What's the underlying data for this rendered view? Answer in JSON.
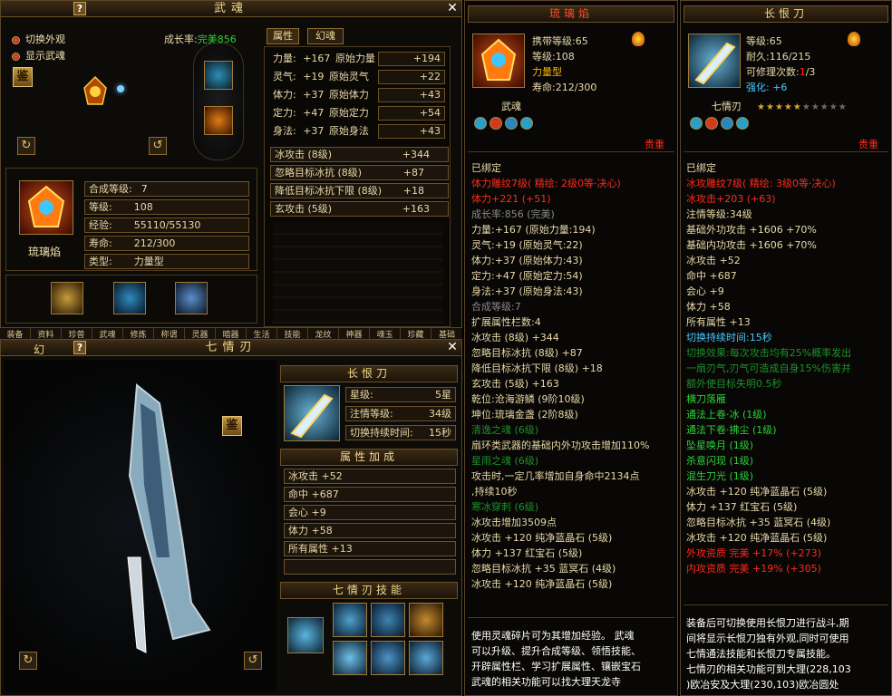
{
  "wuhun": {
    "title": "武魂",
    "opt_switch": "切换外观",
    "opt_show": "显示武魂",
    "growth_label": "成长率:",
    "growth_value": "完美856",
    "jian": "鉴",
    "tabs": [
      "属性",
      "幻魂"
    ],
    "stats": [
      {
        "label": "力量:",
        "base": "+167",
        "orig": "原始力量",
        "val": "+194"
      },
      {
        "label": "灵气:",
        "base": "+19",
        "orig": "原始灵气",
        "val": "+22"
      },
      {
        "label": "体力:",
        "base": "+37",
        "orig": "原始体力",
        "val": "+43"
      },
      {
        "label": "定力:",
        "base": "+47",
        "orig": "原始定力",
        "val": "+54"
      },
      {
        "label": "身法:",
        "base": "+37",
        "orig": "原始身法",
        "val": "+43"
      }
    ],
    "ext": [
      {
        "label": "冰攻击 (8级)",
        "val": "+344"
      },
      {
        "label": "忽略目标冰抗 (8级)",
        "val": "+87"
      },
      {
        "label": "降低目标冰抗下限 (8级)",
        "val": "+18"
      },
      {
        "label": "玄攻击 (5级)",
        "val": "+163"
      }
    ],
    "name": "琉璃焰",
    "info": [
      {
        "k": "合成等级:",
        "v": "7"
      },
      {
        "k": "等级:",
        "v": "108"
      },
      {
        "k": "经验:",
        "v": "55110/55130"
      },
      {
        "k": "寿命:",
        "v": "212/300"
      },
      {
        "k": "类型:",
        "v": "力量型"
      }
    ],
    "tabstrip": [
      "装备",
      "资料",
      "珍兽",
      "武魂",
      "修炼",
      "称谓",
      "灵器",
      "暗器",
      "生活",
      "技能",
      "龙纹",
      "神器",
      "魂玉",
      "珍藏",
      "基础"
    ]
  },
  "qiqing": {
    "title": "七情刃",
    "left_tab": "幻",
    "jian": "鉴",
    "weapon_name": "长恨刀",
    "star_label": "星级:",
    "star_value": "5星",
    "zhuqing_label": "注情等级:",
    "zhuqing_value": "34级",
    "switch_label": "切换持续时间:",
    "switch_value": "15秒",
    "attr_title": "属性加成",
    "attrs": [
      "冰攻击 +52",
      "命中 +687",
      "会心 +9",
      "体力 +58",
      "所有属性 +13"
    ],
    "skill_title": "七情刃技能"
  },
  "tip1": {
    "title": "琉璃焰",
    "l1": "携带等级:65",
    "l2": "等级:108",
    "l3": "力量型",
    "l4": "寿命:212/300",
    "sub": "武魂",
    "bind_tag": "贵重",
    "lines": [
      {
        "t": "已绑定",
        "c": "y"
      },
      {
        "t": "体力雕纹7级( 精绘: 2级0等·决心)",
        "c": "r"
      },
      {
        "t": "体力+221 (+51)",
        "c": "r"
      },
      {
        "t": "成长率:856 (完美)",
        "c": "gr"
      },
      {
        "t": "力量:+167 (原始力量:194)",
        "c": "y"
      },
      {
        "t": "灵气:+19 (原始灵气:22)",
        "c": "y"
      },
      {
        "t": "体力:+37 (原始体力:43)",
        "c": "y"
      },
      {
        "t": "定力:+47 (原始定力:54)",
        "c": "y"
      },
      {
        "t": "身法:+37 (原始身法:43)",
        "c": "y"
      },
      {
        "t": "合成等级:7",
        "c": "gr"
      },
      {
        "t": "扩展属性栏数:4",
        "c": "y"
      },
      {
        "t": "冰攻击 (8级) +344",
        "c": "y"
      },
      {
        "t": "忽略目标冰抗 (8级) +87",
        "c": "y"
      },
      {
        "t": "降低目标冰抗下限 (8级) +18",
        "c": "y"
      },
      {
        "t": "玄攻击 (5级) +163",
        "c": "y"
      },
      {
        "t": "乾位:沧海游鳞 (9阶10级)",
        "c": "y"
      },
      {
        "t": "坤位:琉璃金盏 (2阶8级)",
        "c": "y"
      },
      {
        "t": "清逸之魂 (6级)",
        "c": "dg"
      },
      {
        "t": "扇环类武器的基础内外功攻击增加110%",
        "c": "y"
      },
      {
        "t": "星雨之魂 (6级)",
        "c": "dg"
      },
      {
        "t": "攻击时,一定几率增加自身命中2134点",
        "c": "y"
      },
      {
        "t": ",持续10秒",
        "c": "y"
      },
      {
        "t": "寒冰穿刺 (6级)",
        "c": "dg"
      },
      {
        "t": "冰攻击增加3509点",
        "c": "y"
      },
      {
        "t": "冰攻击 +120 纯净蓝晶石 (5级)",
        "c": "y"
      },
      {
        "t": "体力 +137 红宝石 (5级)",
        "c": "y"
      },
      {
        "t": "忽略目标冰抗 +35 蓝冥石 (4级)",
        "c": "y"
      },
      {
        "t": "冰攻击 +120 纯净蓝晶石 (5级)",
        "c": "y"
      }
    ],
    "foot": [
      "使用灵魂碎片可为其增加经验。 武魂",
      "可以升级、提升合成等级、领悟技能、",
      "开辟属性栏、学习扩展属性、镶嵌宝石",
      "武魂的相关功能可以找大理天龙寺"
    ]
  },
  "tip2": {
    "title": "长恨刀",
    "l1": "等级:65",
    "l2": "耐久:116/215",
    "l3a": "可修理次数:",
    "l3b": "1",
    "l3c": "/3",
    "l4": "强化: +6",
    "sub": "七情刃",
    "stars_on": 5,
    "stars_total": 10,
    "bind_tag": "贵重",
    "lines": [
      {
        "t": "已绑定",
        "c": "y"
      },
      {
        "t": "冰攻雕纹7级( 精绘: 3级0等·决心)",
        "c": "r"
      },
      {
        "t": "冰攻击+203 (+63)",
        "c": "r"
      },
      {
        "t": "注情等级:34级",
        "c": "y"
      },
      {
        "t": "基础外功攻击 +1606 +70%",
        "c": "y"
      },
      {
        "t": "基础内功攻击 +1606 +70%",
        "c": "y"
      },
      {
        "t": "冰攻击 +52",
        "c": "y"
      },
      {
        "t": "命中 +687",
        "c": "y"
      },
      {
        "t": "会心 +9",
        "c": "y"
      },
      {
        "t": "体力 +58",
        "c": "y"
      },
      {
        "t": "所有属性 +13",
        "c": "y"
      },
      {
        "t": "切换持续时间:15秒",
        "c": "c"
      },
      {
        "t": "切换效果:每次攻击均有25%概率发出",
        "c": "dg"
      },
      {
        "t": "一扇刃气,刃气可造成自身15%伤害并",
        "c": "dg"
      },
      {
        "t": "额外使目标失明0.5秒",
        "c": "dg"
      },
      {
        "t": "横刀落雁",
        "c": "g"
      },
      {
        "t": "通法上卷·冰 (1级)",
        "c": "g"
      },
      {
        "t": "通法下卷·拂尘 (1级)",
        "c": "g"
      },
      {
        "t": "坠星唤月 (1级)",
        "c": "g"
      },
      {
        "t": "杀意闪现 (1级)",
        "c": "g"
      },
      {
        "t": "混生刀光 (1级)",
        "c": "g"
      },
      {
        "t": "冰攻击 +120 纯净蓝晶石 (5级)",
        "c": "y"
      },
      {
        "t": "体力 +137 红宝石 (5级)",
        "c": "y"
      },
      {
        "t": "忽略目标冰抗 +35 蓝冥石 (4级)",
        "c": "y"
      },
      {
        "t": "冰攻击 +120 纯净蓝晶石 (5级)",
        "c": "y"
      },
      {
        "t": "外攻资质  完美 +17% (+273)",
        "c": "r"
      },
      {
        "t": "内攻资质  完美 +19% (+305)",
        "c": "r"
      }
    ],
    "foot": [
      "装备后可切换使用长恨刀进行战斗,期",
      "间将显示长恨刀独有外观,同时可使用",
      "七情通法技能和长恨刀专属技能。",
      "七情刃的相关功能可到大理(228,103",
      ")欧冶安及大理(230,103)欧冶圆处"
    ]
  }
}
